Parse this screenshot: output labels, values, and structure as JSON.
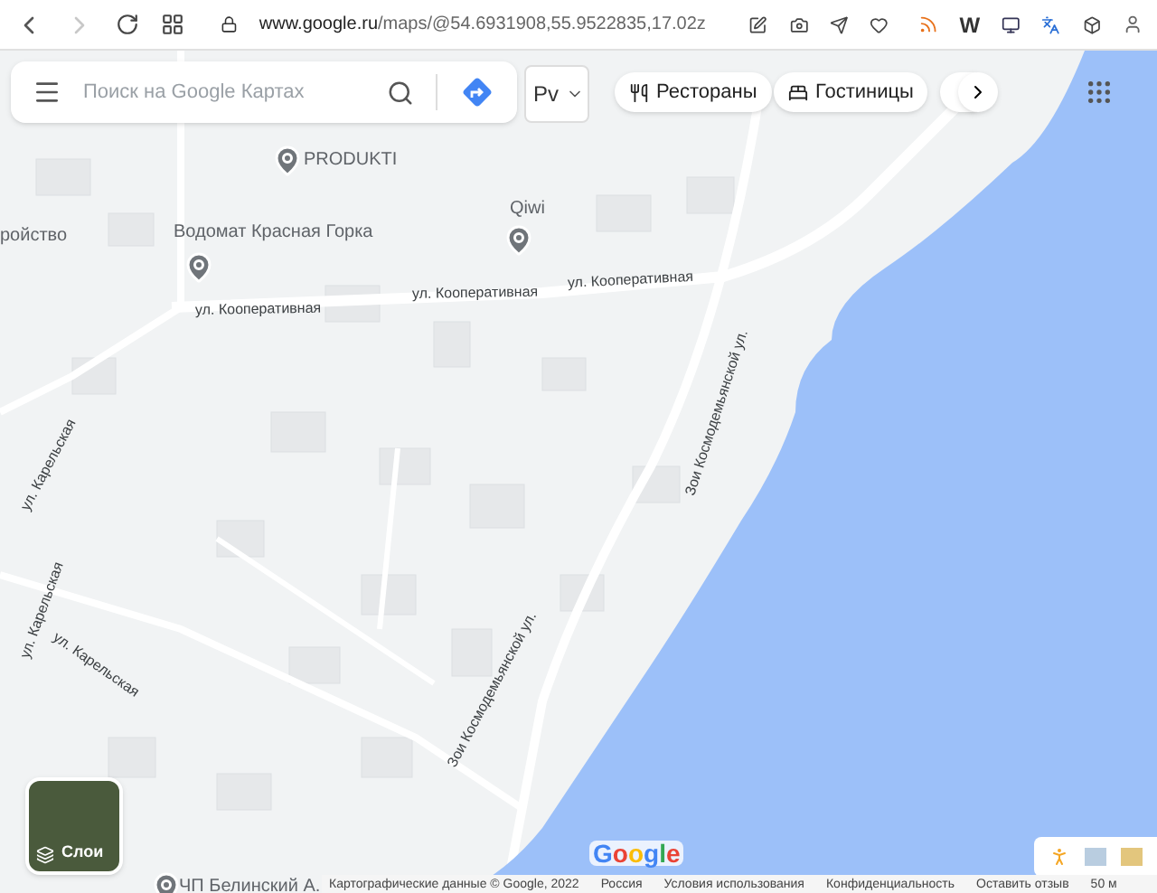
{
  "browser": {
    "nav": [
      {
        "kind": "back",
        "disabled": false
      },
      {
        "kind": "forward",
        "disabled": true
      }
    ],
    "url_host": "www.google.ru",
    "url_path": "/maps/@54.6931908,55.9522835,17.02z",
    "extension_letter": "W"
  },
  "search": {
    "placeholder": "Поиск на Google Картах"
  },
  "mode_label": "Рv",
  "chips": [
    {
      "kind": "restaurant",
      "label": "Рестораны"
    },
    {
      "kind": "hotel",
      "label": "Гостиницы"
    }
  ],
  "map": {
    "pois": [
      {
        "label": "PRODUKTI"
      },
      {
        "label": "Qiwi"
      },
      {
        "label": "ройство"
      },
      {
        "label": "Водомат Красная Горка"
      },
      {
        "label": "ЧП Белинский А."
      }
    ],
    "streets": [
      "ул. Кооперативная",
      "ул. Кооперативная",
      "ул. Кооперативная",
      "ул. Карельская",
      "ул. Карельская",
      "ул. Карельская",
      "Зои Космодемьянской ул.",
      "Зои Космодемьянской ул."
    ]
  },
  "layers": {
    "label": "Слои"
  },
  "logo": "Google",
  "footer": [
    "Картографические данные © Google, 2022",
    "Россия",
    "Условия использования",
    "Конфиденциальность",
    "Оставить отзыв",
    "50 м"
  ]
}
